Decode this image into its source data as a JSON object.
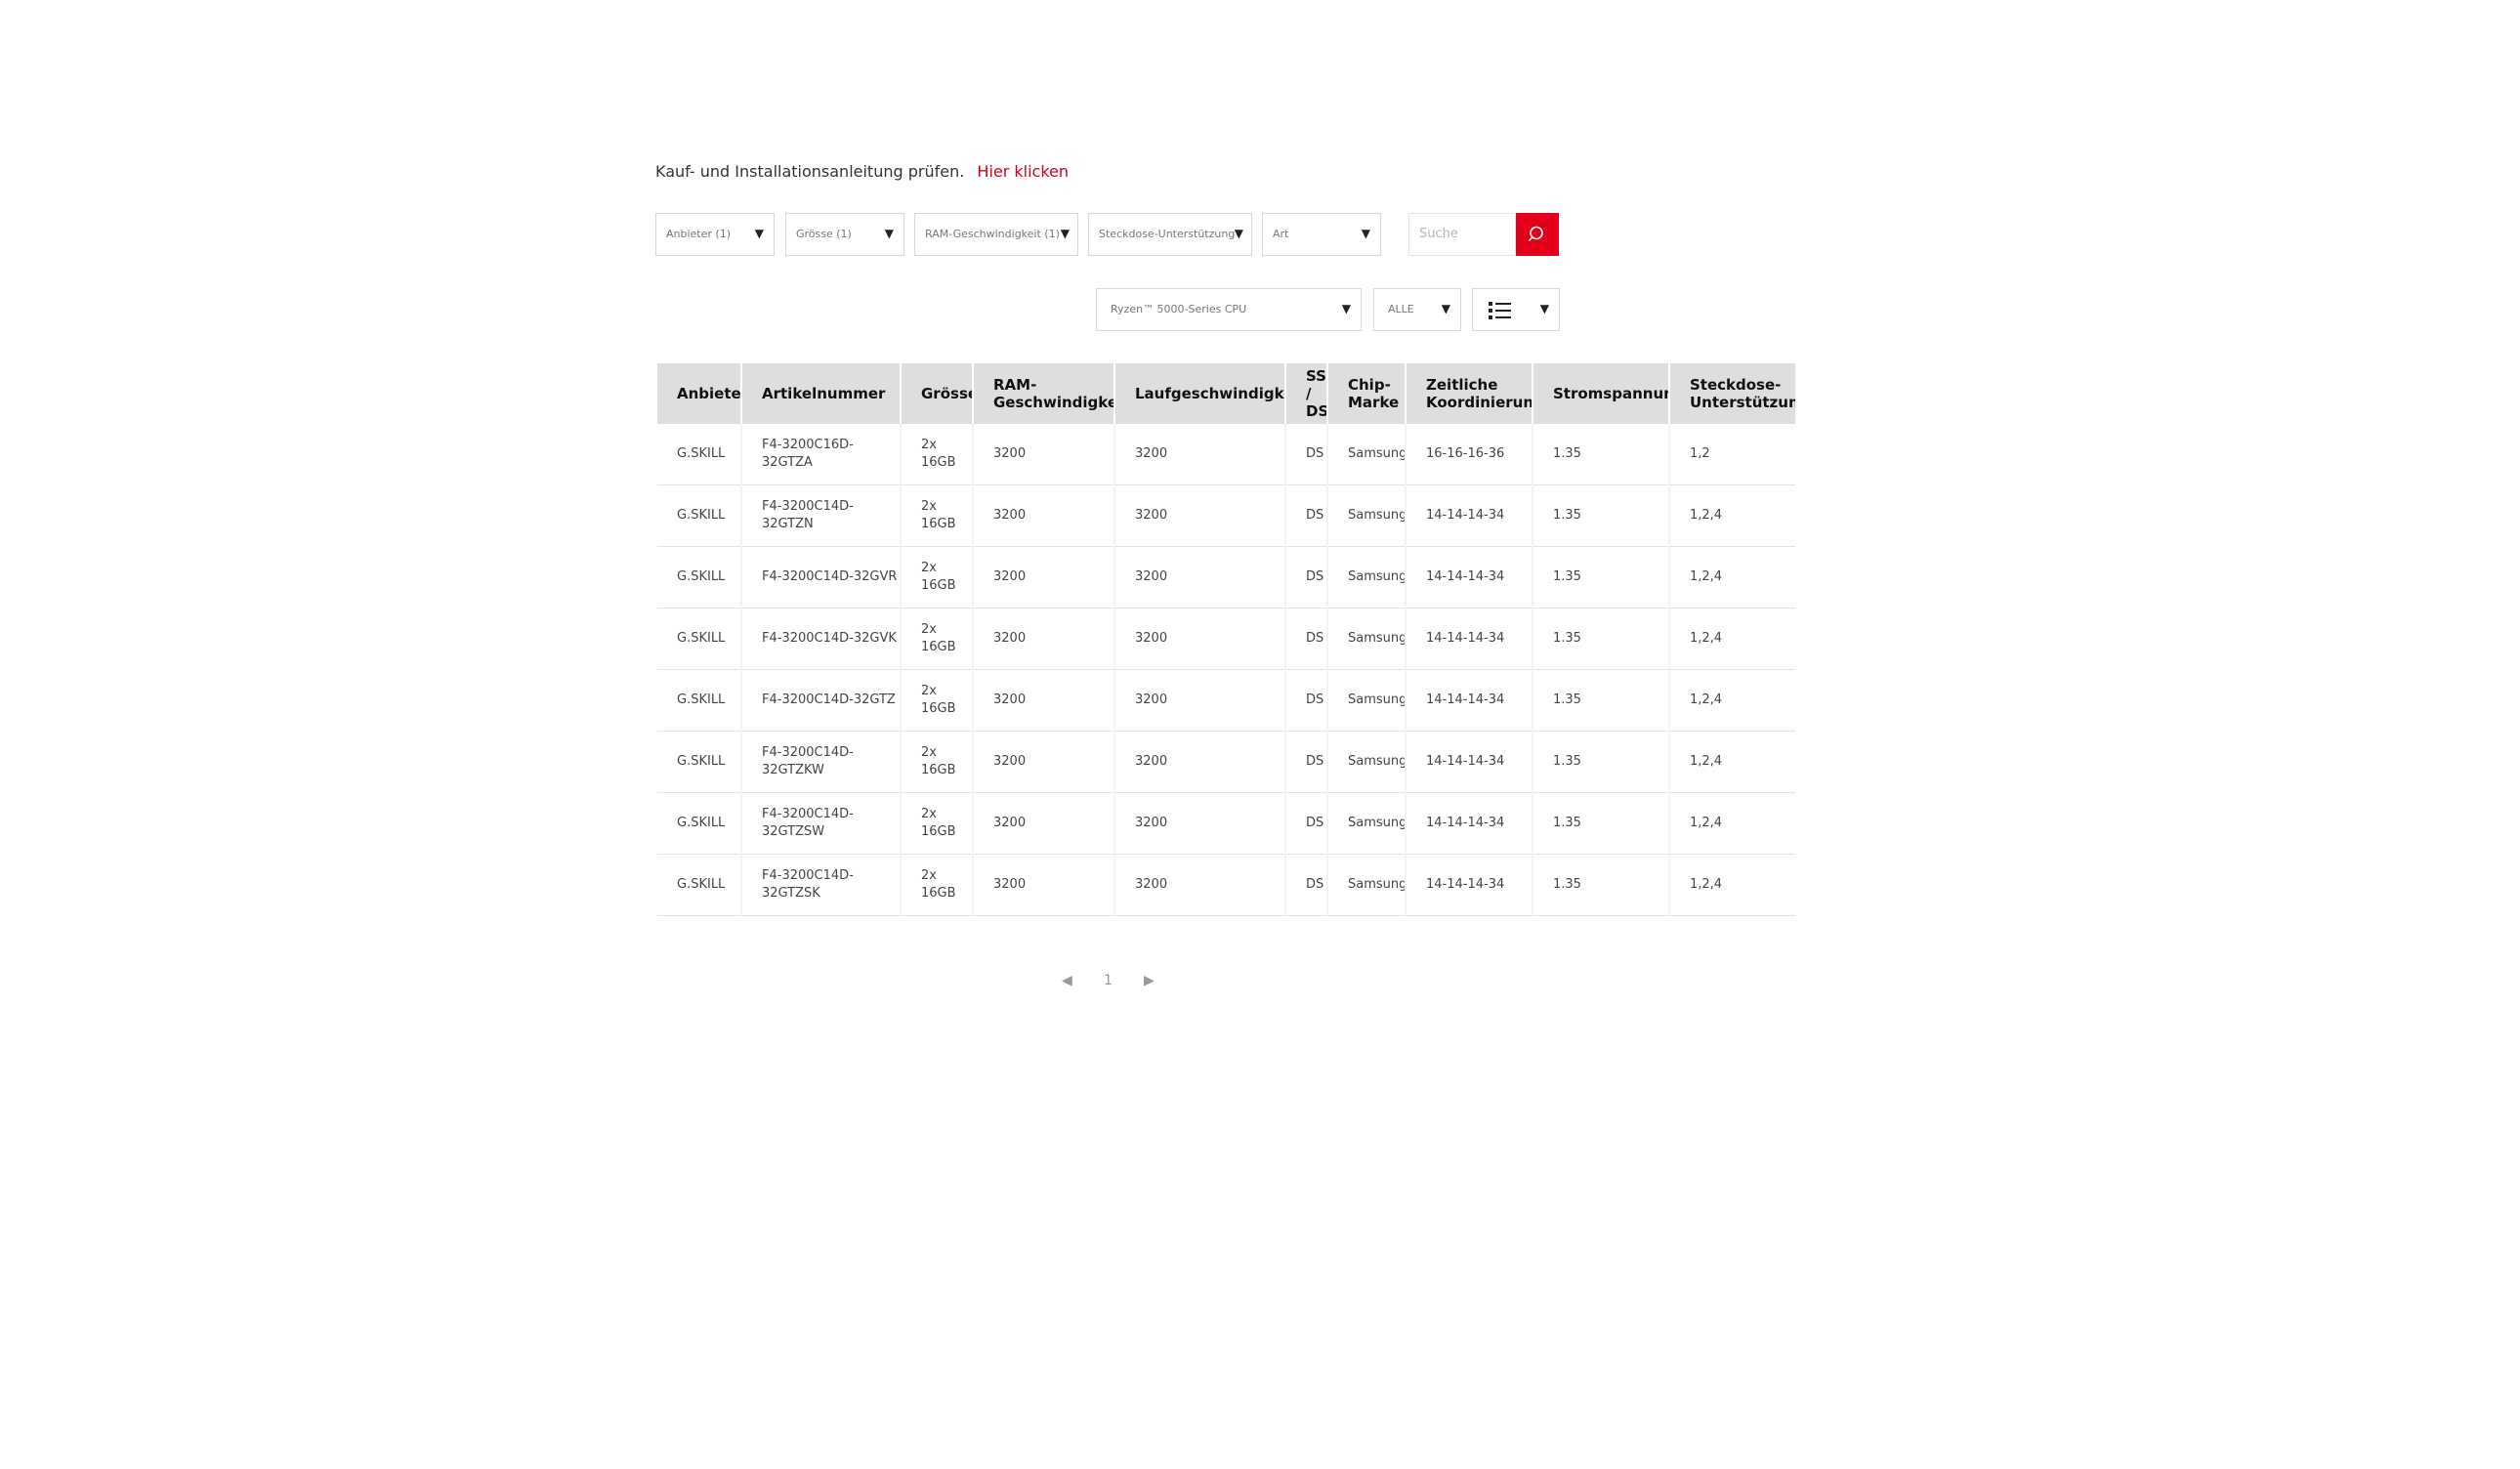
{
  "intro": {
    "text": "Kauf- und Installationsanleitung prüfen.",
    "link": "Hier klicken"
  },
  "filters": [
    {
      "label": "Anbieter (1)"
    },
    {
      "label": "Grösse (1)"
    },
    {
      "label": "RAM-Geschwindigkeit (1)"
    },
    {
      "label": "Steckdose-Unterstützung"
    },
    {
      "label": "Art"
    }
  ],
  "search": {
    "placeholder": "Suche",
    "icon": "search-icon",
    "accent": "#e3001b"
  },
  "cpu_select": {
    "value": "Ryzen™ 5000-Series CPU"
  },
  "all_select": {
    "value": "ALLE"
  },
  "view_toggle": {
    "icon": "list-view-icon"
  },
  "table": {
    "headers": [
      "Anbieter",
      "Artikelnummer",
      "Grösse",
      "RAM-Geschwindigkeit",
      "Laufgeschwindigkeit",
      "SS / DS",
      "Chip-Marke",
      "Zeitliche Koordinierung",
      "Stromspannung",
      "Steckdose-Unterstützung"
    ],
    "rows": [
      [
        "G.SKILL",
        "F4-3200C16D-32GTZA",
        "2x 16GB",
        "3200",
        "3200",
        "DS",
        "Samsung",
        "16-16-16-36",
        "1.35",
        "1,2"
      ],
      [
        "G.SKILL",
        "F4-3200C14D-32GTZN",
        "2x 16GB",
        "3200",
        "3200",
        "DS",
        "Samsung",
        "14-14-14-34",
        "1.35",
        "1,2,4"
      ],
      [
        "G.SKILL",
        "F4-3200C14D-32GVR",
        "2x 16GB",
        "3200",
        "3200",
        "DS",
        "Samsung",
        "14-14-14-34",
        "1.35",
        "1,2,4"
      ],
      [
        "G.SKILL",
        "F4-3200C14D-32GVK",
        "2x 16GB",
        "3200",
        "3200",
        "DS",
        "Samsung",
        "14-14-14-34",
        "1.35",
        "1,2,4"
      ],
      [
        "G.SKILL",
        "F4-3200C14D-32GTZ",
        "2x 16GB",
        "3200",
        "3200",
        "DS",
        "Samsung",
        "14-14-14-34",
        "1.35",
        "1,2,4"
      ],
      [
        "G.SKILL",
        "F4-3200C14D-32GTZKW",
        "2x 16GB",
        "3200",
        "3200",
        "DS",
        "Samsung",
        "14-14-14-34",
        "1.35",
        "1,2,4"
      ],
      [
        "G.SKILL",
        "F4-3200C14D-32GTZSW",
        "2x 16GB",
        "3200",
        "3200",
        "DS",
        "Samsung",
        "14-14-14-34",
        "1.35",
        "1,2,4"
      ],
      [
        "G.SKILL",
        "F4-3200C14D-32GTZSK",
        "2x 16GB",
        "3200",
        "3200",
        "DS",
        "Samsung",
        "14-14-14-34",
        "1.35",
        "1,2,4"
      ]
    ]
  },
  "pagination": {
    "prev": "◀",
    "page": "1",
    "next": "▶"
  }
}
